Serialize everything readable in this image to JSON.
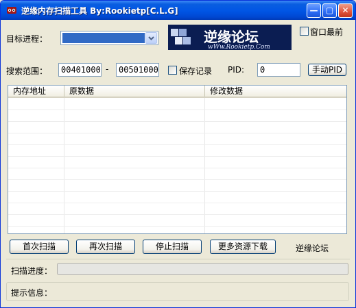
{
  "window": {
    "title": "逆缘内存扫描工具 By:Rookietp[C.L.G]",
    "controls": {
      "minimize": "—",
      "restore": "▢",
      "close": "✕"
    }
  },
  "banner": {
    "main_text": "逆缘论坛",
    "sub_text": "wWw.Rookietp.Com"
  },
  "target": {
    "label": "目标进程：",
    "selected": ""
  },
  "topmost": {
    "label": "窗口最前",
    "checked": false
  },
  "range": {
    "label": "搜索范围：",
    "start": "00401000",
    "dash": "-",
    "end": "00501000"
  },
  "save_record": {
    "label": "保存记录",
    "checked": false
  },
  "pid": {
    "label": "PID:",
    "value": "0",
    "button": "手动PID"
  },
  "table": {
    "columns": [
      "内存地址",
      "原数据",
      "修改数据"
    ],
    "rows": []
  },
  "buttons": {
    "first_scan": "首次扫描",
    "rescan": "再次扫描",
    "stop_scan": "停止扫描",
    "more_downloads": "更多资源下载",
    "forum_link": "逆缘论坛"
  },
  "progress": {
    "label": "扫描进度：",
    "value": 0
  },
  "info": {
    "label": "提示信息：",
    "text": ""
  },
  "colors": {
    "title_bar": "#0055e5",
    "selection": "#316ac5",
    "window_bg": "#ece9d8"
  }
}
